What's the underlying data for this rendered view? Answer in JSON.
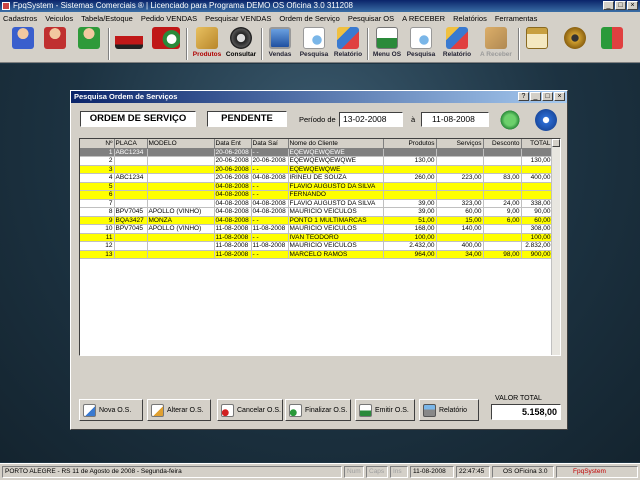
{
  "app": {
    "title": "FpqSystem - Sistemas Comerciais ® | Licenciado para  Programa DEMO OS Oficina 3.0 311208",
    "menu": [
      "Cadastros",
      "Veiculos",
      "Tabela/Estoque",
      "Pedido VENDAS",
      "Pesquisar VENDAS",
      "Ordem de Serviço",
      "Pesquisar OS",
      "A RECEBER",
      "Relatórios",
      "Ferramentas"
    ],
    "toolbar": [
      {
        "icon": "user-blue-icon",
        "label": ""
      },
      {
        "icon": "user-red-icon",
        "label": ""
      },
      {
        "icon": "user-green-icon",
        "label": ""
      },
      {
        "icon": "car-icon",
        "label": ""
      },
      {
        "icon": "car-clock-icon",
        "label": ""
      },
      {
        "icon": "boxes-icon",
        "label": "Produtos"
      },
      {
        "icon": "tire-icon",
        "label": "Consultar"
      },
      {
        "icon": "monitor-icon",
        "label": "Vendas"
      },
      {
        "icon": "search-doc-icon",
        "label": "Pesquisa"
      },
      {
        "icon": "report-icon",
        "label": "Relatório"
      },
      {
        "icon": "menu-os-icon",
        "label": "Menu OS"
      },
      {
        "icon": "search-os-icon",
        "label": "Pesquisa"
      },
      {
        "icon": "report-os-icon",
        "label": "Relatório"
      },
      {
        "icon": "money-icon",
        "label": "A Receber"
      },
      {
        "icon": "calculator-icon",
        "label": ""
      },
      {
        "icon": "coin-icon",
        "label": ""
      },
      {
        "icon": "exit-icon",
        "label": ""
      }
    ],
    "colors": {
      "title_bar": "#0a246a",
      "yellow_row": "#ffff00",
      "selected_row": "#808080",
      "face": "#d4d0c8"
    }
  },
  "dialog": {
    "title": "Pesquisa Ordem de Serviços",
    "heading": "ORDEM DE SERVIÇO",
    "status": "PENDENTE",
    "period_label": "Período de",
    "date_from": "13-02-2008",
    "date_sep": "à",
    "date_to": "11-08-2008",
    "columns": [
      "Nº",
      "PLACA",
      "MODELO",
      "Data Ent",
      "Data Saí",
      "Nome do Cliente",
      "Produtos",
      "Serviços",
      "Desconto",
      "TOTAL"
    ],
    "rows": [
      {
        "style": "sel",
        "cells": [
          "1",
          "ABC1234",
          "",
          "20-06-2008",
          " - - ",
          "EQEWQEWQEWE",
          "",
          "",
          "",
          ""
        ]
      },
      {
        "style": "white",
        "cells": [
          "2",
          "",
          "",
          "20-06-2008",
          "20-06-2008",
          "EQEWQEWQEWQWE",
          "130,00",
          "",
          "",
          "130,00"
        ]
      },
      {
        "style": "yellow",
        "cells": [
          "3",
          "",
          "",
          "20-06-2008",
          " - - ",
          "EQEWQEWQWE",
          "",
          "",
          "",
          ""
        ]
      },
      {
        "style": "white",
        "cells": [
          "4",
          "ABC1234",
          "",
          "20-06-2008",
          "04-08-2008",
          "IRINEU DE SOUZA",
          "260,00",
          "223,00",
          "83,00",
          "400,00"
        ]
      },
      {
        "style": "yellow",
        "cells": [
          "5",
          "",
          "",
          "04-08-2008",
          " - - ",
          "FLAVIO AUGUSTO DA SILVA",
          "",
          "",
          "",
          ""
        ]
      },
      {
        "style": "yellow",
        "cells": [
          "6",
          "",
          "",
          "04-08-2008",
          " - - ",
          "FERNANDO",
          "",
          "",
          "",
          ""
        ]
      },
      {
        "style": "white",
        "cells": [
          "7",
          "",
          "",
          "04-08-2008",
          "04-08-2008",
          "FLAVIO AUGUSTO DA SILVA",
          "39,00",
          "323,00",
          "24,00",
          "338,00"
        ]
      },
      {
        "style": "white",
        "cells": [
          "8",
          "BPV7045",
          "APOLLO (VINHO)",
          "04-08-2008",
          "04-08-2008",
          "MAURICIO VEICULOS",
          "39,00",
          "60,00",
          "9,00",
          "90,00"
        ]
      },
      {
        "style": "yellow",
        "cells": [
          "9",
          "BQA3427",
          "MONZA",
          "04-08-2008",
          " - - ",
          "PONTO 1 MULTIMARCAS",
          "51,00",
          "15,00",
          "6,00",
          "60,00"
        ]
      },
      {
        "style": "white",
        "cells": [
          "10",
          "BPV7045",
          "APOLLO (VINHO)",
          "11-08-2008",
          "11-08-2008",
          "MAURICIO VEICULOS",
          "168,00",
          "140,00",
          "",
          "308,00"
        ]
      },
      {
        "style": "yellow",
        "cells": [
          "11",
          "",
          "",
          "11-08-2008",
          " - - ",
          "IVAN TEODORO",
          "100,00",
          "",
          "",
          "100,00"
        ]
      },
      {
        "style": "white",
        "cells": [
          "12",
          "",
          "",
          "11-08-2008",
          "11-08-2008",
          "MAURICIO VEICULOS",
          "2.432,00",
          "400,00",
          "",
          "2.832,00"
        ]
      },
      {
        "style": "yellow",
        "cells": [
          "13",
          "",
          "",
          "11-08-2008",
          " - - ",
          "MARCELO RAMOS",
          "964,00",
          "34,00",
          "98,00",
          "900,00"
        ]
      }
    ],
    "buttons": [
      {
        "name": "nova-os-button",
        "icon": "new-doc-icon",
        "label": "Nova O.S."
      },
      {
        "name": "alterar-os-button",
        "icon": "edit-doc-icon",
        "label": "Alterar O.S."
      },
      {
        "name": "cancelar-os-button",
        "icon": "cancel-doc-icon",
        "label": "Cancelar O.S."
      },
      {
        "name": "finalizar-os-button",
        "icon": "finish-doc-icon",
        "label": "Finalizar O.S."
      },
      {
        "name": "emitir-os-button",
        "icon": "print-doc-icon",
        "label": "Emitir O.S."
      },
      {
        "name": "relatorio-button",
        "icon": "printer-icon",
        "label": "Relatório"
      }
    ],
    "valor_total_label": "VALOR TOTAL",
    "valor_total": "5.158,00"
  },
  "statusbar": {
    "location": "PORTO ALEGRE - RS 11 de Agosto de 2008 - Segunda-feira",
    "num": "Num",
    "caps": "Caps",
    "ins": "Ins",
    "date": "11-08-2008",
    "time": "22:47:45",
    "os": "OS OFicina 3.0",
    "brand": "FpqSystem"
  }
}
